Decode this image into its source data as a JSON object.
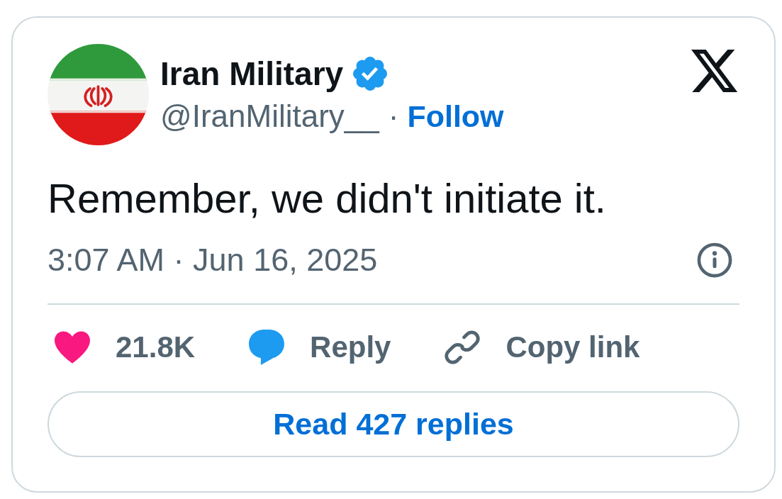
{
  "tweet": {
    "author": {
      "name": "Iran Military",
      "verified": true,
      "handle": "@IranMilitary__",
      "separator": "·",
      "follow": "Follow"
    },
    "text": "Remember, we didn't initiate it.",
    "timestamp": "3:07 AM · Jun 16, 2025",
    "actions": [
      {
        "kind": "like",
        "label": "21.8K"
      },
      {
        "kind": "reply",
        "label": "Reply"
      },
      {
        "kind": "copy",
        "label": "Copy link"
      }
    ],
    "read_replies": "Read 427 replies"
  }
}
